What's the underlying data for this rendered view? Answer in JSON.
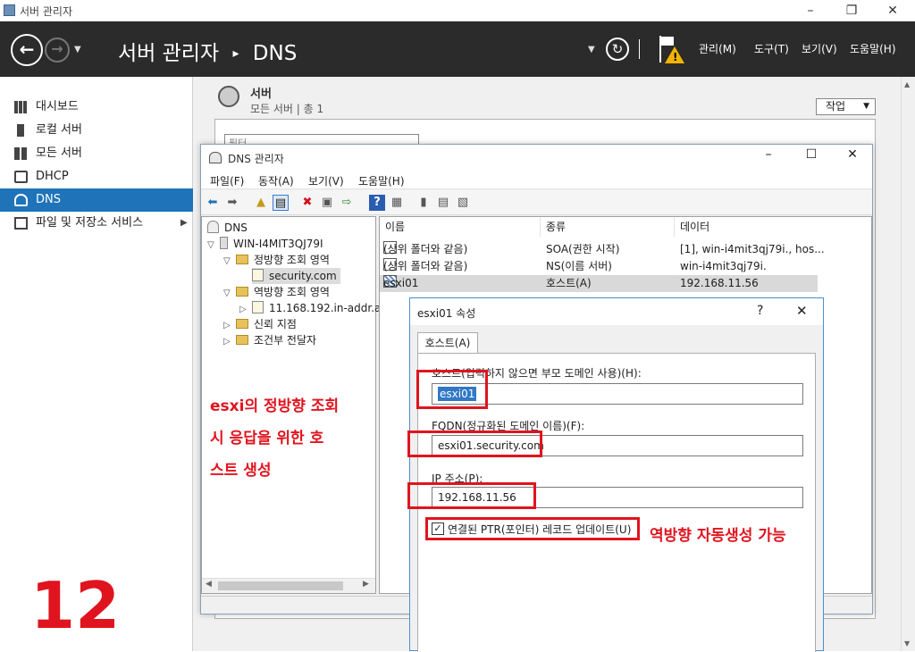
{
  "window": {
    "title": "서버 관리자"
  },
  "header": {
    "breadcrumb_root": "서버 관리자",
    "breadcrumb_sep": "▸",
    "breadcrumb_page": "DNS",
    "menu": [
      "관리(M)",
      "도구(T)",
      "보기(V)",
      "도움말(H)"
    ]
  },
  "sidebar": {
    "items": [
      {
        "label": "대시보드",
        "icon": "dashboard-icon"
      },
      {
        "label": "로컬 서버",
        "icon": "local-server-icon"
      },
      {
        "label": "모든 서버",
        "icon": "all-servers-icon"
      },
      {
        "label": "DHCP",
        "icon": "dhcp-icon"
      },
      {
        "label": "DNS",
        "icon": "dns-icon"
      },
      {
        "label": "파일 및 저장소 서비스",
        "icon": "file-storage-icon"
      }
    ],
    "selected": "DNS"
  },
  "servers": {
    "title": "서버",
    "subtitle": "모든 서버 | 총 1",
    "tasks_label": "작업",
    "filter_placeholder": "필터"
  },
  "dns_window": {
    "title": "DNS 관리자",
    "menu": [
      "파일(F)",
      "동작(A)",
      "보기(V)",
      "도움말(H)"
    ],
    "tree": {
      "root": "DNS",
      "server": "WIN-I4MIT3QJ79I",
      "forward": "정방향 조회 영역",
      "forward_zone": "security.com",
      "reverse": "역방향 조회 영역",
      "reverse_zone": "11.168.192.in-addr.a",
      "trust": "신뢰 지점",
      "conditional": "조건부 전달자"
    },
    "columns": [
      "이름",
      "종류",
      "데이터"
    ],
    "rows": [
      {
        "name": "(상위 폴더와 같음)",
        "type": "SOA(권한 시작)",
        "data": "[1], win-i4mit3qj79i., hos..."
      },
      {
        "name": "(상위 폴더와 같음)",
        "type": "NS(이름 서버)",
        "data": "win-i4mit3qj79i."
      },
      {
        "name": "esxi01",
        "type": "호스트(A)",
        "data": "192.168.11.56"
      }
    ]
  },
  "props_dialog": {
    "title": "esxi01 속성",
    "help": "?",
    "close": "✕",
    "tab": "호스트(A)",
    "host_label": "호스트(입력하지 않으면 부모 도메인 사용)(H):",
    "host_value": "esxi01",
    "fqdn_label": "FQDN(정규화된 도메인 이름)(F):",
    "fqdn_value": "esxi01.security.com",
    "ip_label": "IP 주소(P):",
    "ip_value": "192.168.11.56",
    "ptr_label": "연결된 PTR(포인터) 레코드 업데이트(U)",
    "ptr_checked": true
  },
  "annotations": {
    "left_line1": "esxi의 정방향 조회",
    "left_line2": "시 응답을 위한 호",
    "left_line3": "스트 생성",
    "right": "역방향 자동생성 가능",
    "step": "12"
  },
  "colors": {
    "header": "#2b2b2b",
    "selected": "#1e73b9",
    "annotation": "#e0141e"
  }
}
